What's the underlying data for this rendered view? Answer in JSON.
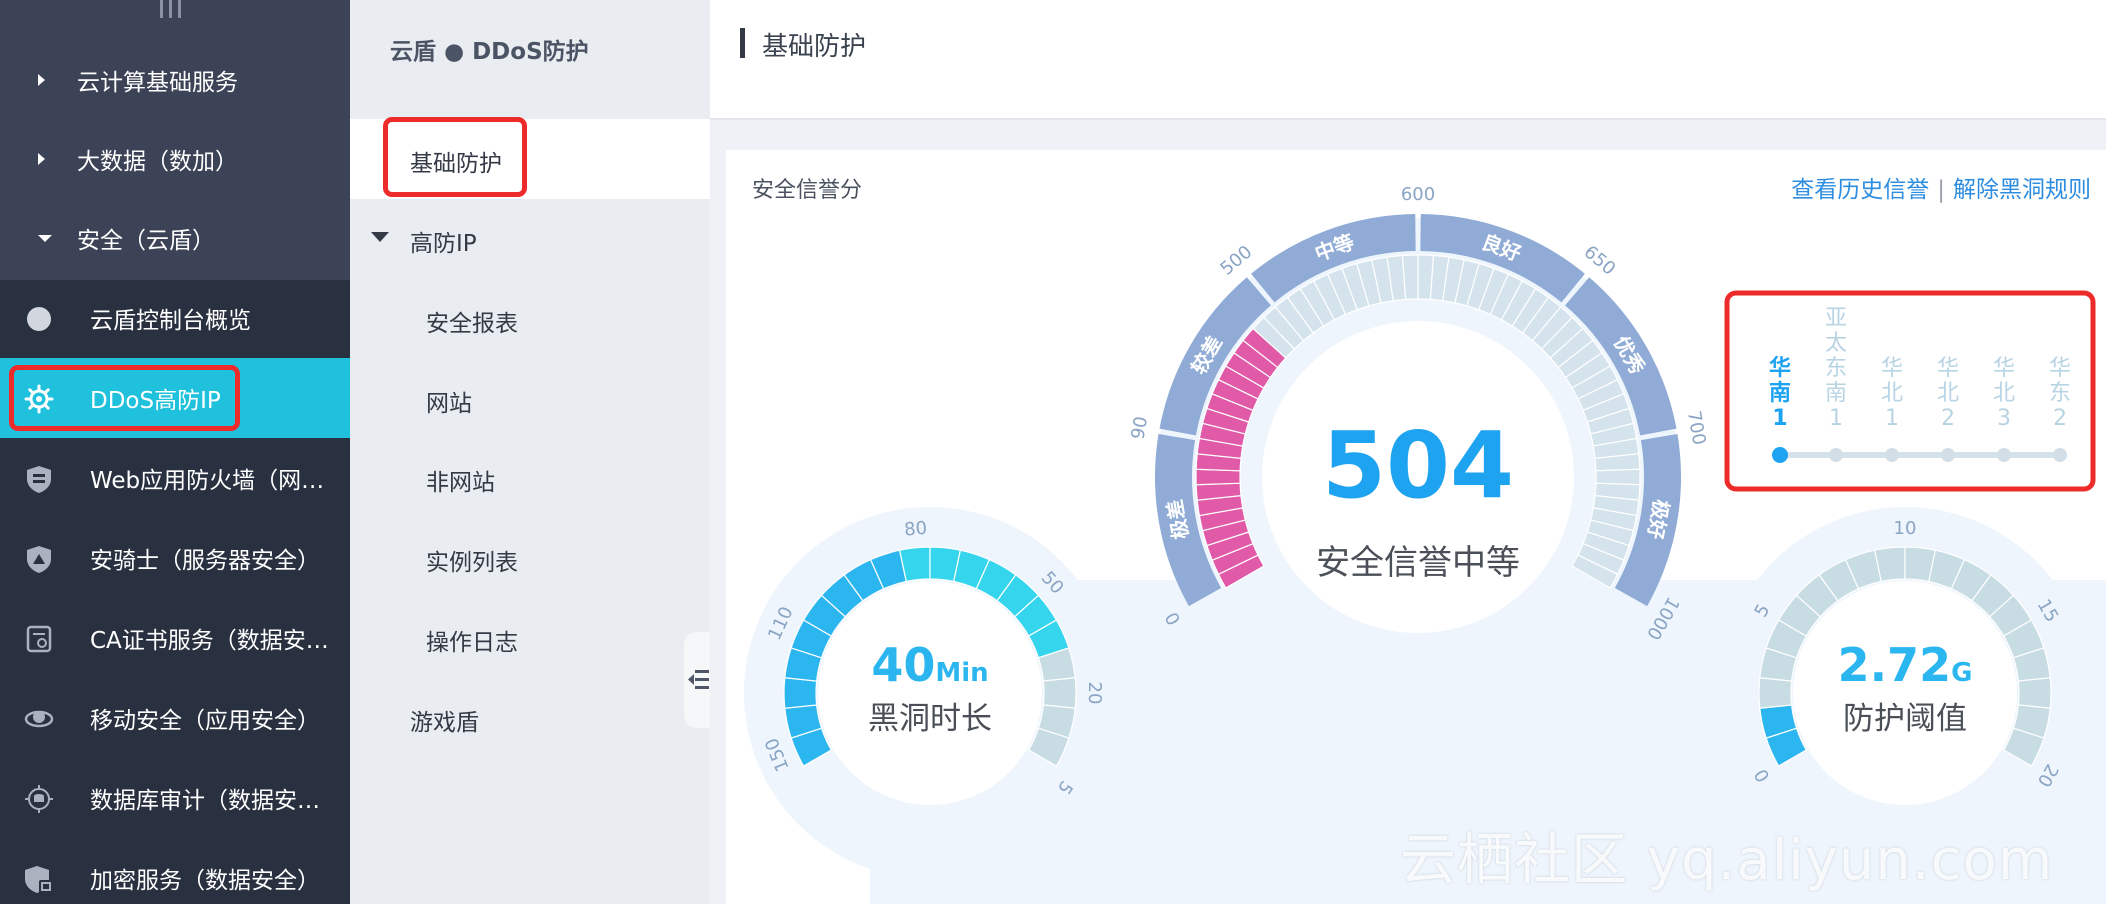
{
  "sidebar": {
    "categories": [
      {
        "label": "云计算基础服务",
        "expanded": false
      },
      {
        "label": "大数据（数加）",
        "expanded": false
      },
      {
        "label": "安全（云盾）",
        "expanded": true
      }
    ],
    "items": [
      {
        "label": "云盾控制台概览",
        "icon": "circle-icon"
      },
      {
        "label": "DDoS高防IP",
        "icon": "gear-shield-icon",
        "active": true
      },
      {
        "label": "Web应用防火墙（网…",
        "icon": "firewall-shield-icon"
      },
      {
        "label": "安骑士（服务器安全）",
        "icon": "rider-shield-icon"
      },
      {
        "label": "CA证书服务（数据安…",
        "icon": "certificate-icon"
      },
      {
        "label": "移动安全（应用安全）",
        "icon": "mobile-security-icon"
      },
      {
        "label": "数据库审计（数据安…",
        "icon": "database-audit-icon"
      },
      {
        "label": "加密服务（数据安全）",
        "icon": "encryption-icon"
      }
    ]
  },
  "subnav": {
    "title": "云盾 ● DDoS防护",
    "basic": "基础防护",
    "group": "高防IP",
    "group_items": [
      "安全报表",
      "网站",
      "非网站",
      "实例列表",
      "操作日志"
    ],
    "game": "游戏盾"
  },
  "header": {
    "title": "基础防护"
  },
  "panel": {
    "label": "安全信誉分",
    "link_history": "查看历史信誉",
    "link_separator": "|",
    "link_rules": "解除黑洞规则"
  },
  "score_gauge": {
    "value": "504",
    "caption": "安全信誉中等",
    "segments": [
      "极差",
      "较差",
      "中等",
      "良好",
      "优秀",
      "极好"
    ],
    "ticks": [
      "0",
      "90",
      "500",
      "600",
      "650",
      "700",
      "1000"
    ],
    "fill_fraction": 0.3
  },
  "blackhole_gauge": {
    "value": "40",
    "unit": "Min",
    "caption": "黑洞时长",
    "ticks": [
      "150",
      "110",
      "80",
      "50",
      "20",
      "5"
    ],
    "fill_fraction": 0.82
  },
  "threshold_gauge": {
    "value": "2.72",
    "unit": "G",
    "caption": "防护阈值",
    "ticks": [
      "0",
      "5",
      "10",
      "15",
      "20"
    ],
    "fill_fraction": 0.12
  },
  "regions": [
    {
      "name": "华南1",
      "active": true
    },
    {
      "name": "亚太东南1",
      "active": false
    },
    {
      "name": "华北1",
      "active": false
    },
    {
      "name": "华北2",
      "active": false
    },
    {
      "name": "华北3",
      "active": false
    },
    {
      "name": "华东2",
      "active": false
    }
  ],
  "watermark": "云栖社区 yq.aliyun.com",
  "colors": {
    "sidebar_bg": "#293040",
    "active_item": "#1fc1dc",
    "highlight_border": "#ee2b2b",
    "link": "#2d8de0",
    "score_value": "#1ea3f0",
    "gauge_band": "#8fabd6",
    "gauge_pink": "#e05aa8",
    "gauge_blue": "#2cb6f0",
    "gauge_cyan": "#36d5ee",
    "gauge_empty": "#c8dce4"
  }
}
